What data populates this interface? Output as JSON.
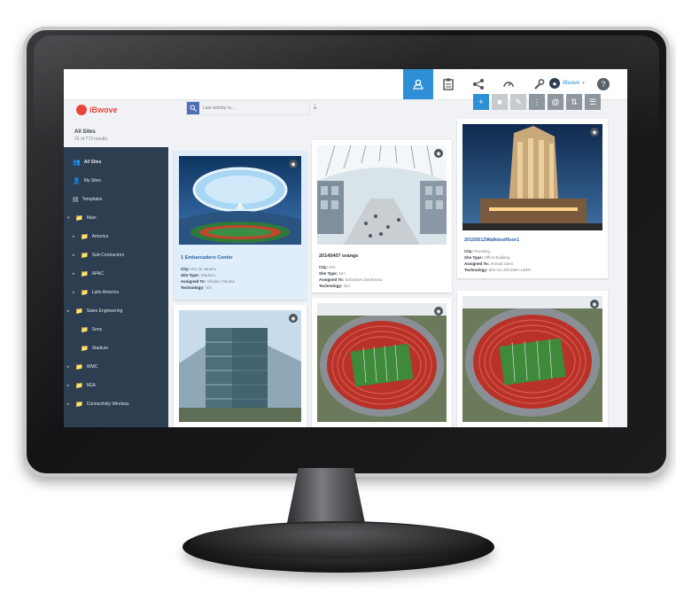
{
  "app": {
    "logo_text": "iBwove"
  },
  "search": {
    "placeholder": "Last activity ro..."
  },
  "user": {
    "name": "iBwave"
  },
  "help": {
    "label": "?"
  },
  "list": {
    "title": "All Sites",
    "count": "26 of 773 results"
  },
  "sidebar": {
    "items": [
      {
        "label": "All Sites"
      },
      {
        "label": "My Sites"
      },
      {
        "label": "Templates"
      },
      {
        "label": "Main"
      },
      {
        "label": "America"
      },
      {
        "label": "Sub-Contractors"
      },
      {
        "label": "APAC"
      },
      {
        "label": "Latin America"
      },
      {
        "label": "Sales Engineering"
      },
      {
        "label": "Sony"
      },
      {
        "label": "Stadium"
      },
      {
        "label": "WMC"
      },
      {
        "label": "NEA"
      },
      {
        "label": "Connectivity Wireless"
      }
    ]
  },
  "cards": [
    {
      "title": "1 Embarcadero Center",
      "city_label": "City:",
      "city": "Rio de Janeiro",
      "type_label": "Site Type:",
      "type": "Stadium",
      "assigned_label": "Assigned To:",
      "assigned": "Villalani Tiburtia",
      "tech_label": "Technology:",
      "tech": "N/A"
    },
    {
      "title": "20140407 orange",
      "city_label": "City:",
      "city": "N/A",
      "type_label": "Site Type:",
      "type": "N/A",
      "assigned_label": "Assigned To:",
      "assigned": "Sebastien Dambresa",
      "tech_label": "Technology:",
      "tech": "N/A"
    },
    {
      "title": "20150512Walktestfloor1",
      "city_label": "City:",
      "city": "Roosting",
      "type_label": "Site Type:",
      "type": "Office Building",
      "assigned_label": "Assigned To:",
      "assigned": "Ahmad Sami",
      "tech_label": "Technology:",
      "tech": "802.11n,WCDMA,HSPA"
    }
  ],
  "colors": {
    "accent": "#2f8fd6",
    "sidebar": "#2c3e50",
    "brand": "#e8443c"
  }
}
